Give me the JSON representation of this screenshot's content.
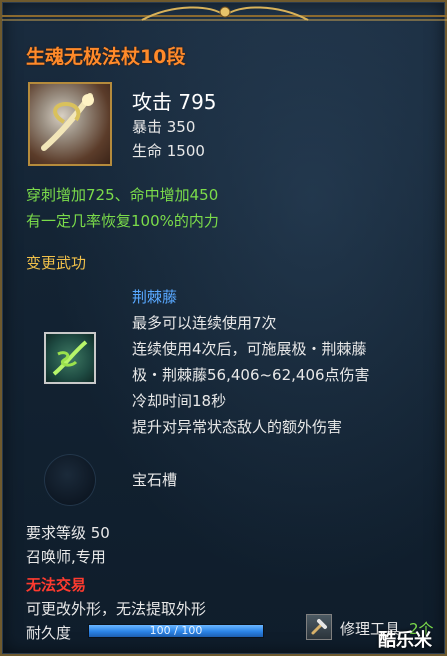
{
  "item": {
    "name": "生魂无极法杖10段",
    "attack": "攻击 795",
    "crit": "暴击 350",
    "hp": "生命 1500"
  },
  "bonuses": [
    "穿刺增加725、命中增加450",
    "有一定几率恢复100%的内力"
  ],
  "section": {
    "title": "变更武功"
  },
  "skill": {
    "name": "荆棘藤",
    "lines": [
      "最多可以连续使用7次",
      "连续使用4次后，可施展极・荆棘藤",
      "极・荆棘藤56,406~62,406点伤害",
      "冷却时间18秒",
      "提升对异常状态敌人的额外伤害"
    ]
  },
  "gem": {
    "label": "宝石槽"
  },
  "requirements": {
    "level": "要求等级 50",
    "class": "召唤师,专用"
  },
  "trade": {
    "status": "无法交易",
    "appearance": "可更改外形，无法提取外形"
  },
  "durability": {
    "label": "耐久度",
    "text": "100 / 100",
    "fraction": 1.0
  },
  "repair": {
    "label": "修理工具",
    "count": "2个"
  },
  "watermark": "酷乐米",
  "icons": {
    "item": "staff-icon",
    "skill": "vine-skill-icon",
    "gem": "gem-slot-icon",
    "repair": "hammer-icon"
  },
  "colors": {
    "title": "#ff8a2a",
    "bonus": "#7bdc4a",
    "section": "#f0c04a",
    "skill_name": "#58a8ff",
    "warning": "#ff3b2f"
  }
}
